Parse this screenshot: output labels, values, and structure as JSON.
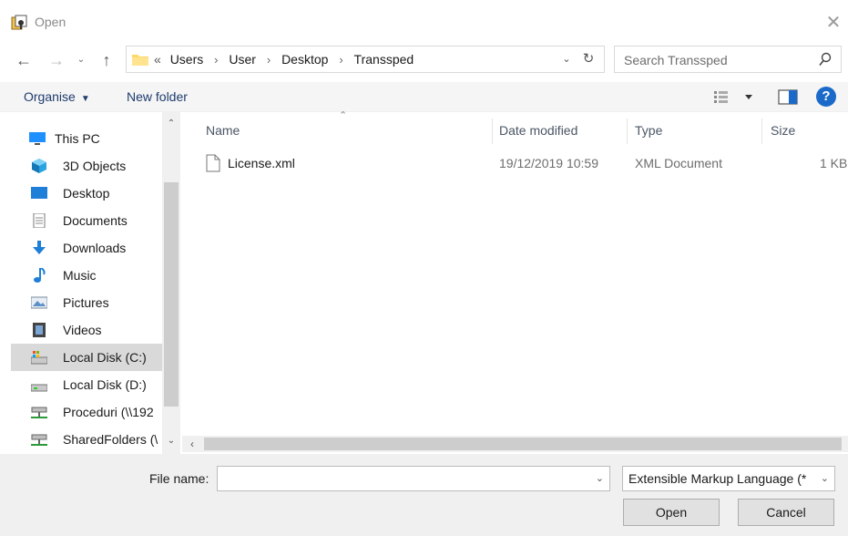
{
  "window": {
    "title": "Open",
    "close_glyph": "✕"
  },
  "nav": {
    "back_glyph": "←",
    "forward_glyph": "→",
    "recent_glyph": "⌄",
    "up_glyph": "↑"
  },
  "address": {
    "overflow": "«",
    "crumbs": [
      "Users",
      "User",
      "Desktop",
      "Transsped"
    ],
    "separator": "›",
    "dropdown_glyph": "⌄",
    "refresh_glyph": "↻"
  },
  "search": {
    "placeholder": "Search Transsped"
  },
  "toolbar": {
    "organise_label": "Organise",
    "organise_caret": "▼",
    "new_folder_label": "New folder",
    "help_glyph": "?"
  },
  "navpane": {
    "items": [
      {
        "label": "This PC",
        "icon": "computer-icon"
      },
      {
        "label": "3D Objects",
        "icon": "cube-icon"
      },
      {
        "label": "Desktop",
        "icon": "desktop-icon"
      },
      {
        "label": "Documents",
        "icon": "documents-icon"
      },
      {
        "label": "Downloads",
        "icon": "download-icon"
      },
      {
        "label": "Music",
        "icon": "music-icon"
      },
      {
        "label": "Pictures",
        "icon": "pictures-icon"
      },
      {
        "label": "Videos",
        "icon": "videos-icon"
      },
      {
        "label": "Local Disk (C:)",
        "icon": "drive-icon"
      },
      {
        "label": "Local Disk (D:)",
        "icon": "drive-icon"
      },
      {
        "label": "Proceduri (\\\\192",
        "icon": "network-drive-icon"
      },
      {
        "label": "SharedFolders (\\",
        "icon": "network-drive-icon"
      }
    ],
    "selected": "Local Disk (C:)",
    "scroll_up_glyph": "⌃",
    "scroll_down_glyph": "⌄"
  },
  "filelist": {
    "columns": {
      "name": "Name",
      "date": "Date modified",
      "type": "Type",
      "size": "Size"
    },
    "sort_glyph": "⌃",
    "rows": [
      {
        "name": "License.xml",
        "date": "19/12/2019 10:59",
        "type": "XML Document",
        "size": "1 KB"
      }
    ],
    "hscroll_left_glyph": "‹"
  },
  "footer": {
    "file_name_label": "File name:",
    "file_name_value": "",
    "file_name_dropdown": "⌄",
    "filter_label": "Extensible Markup Language (*",
    "filter_dropdown": "⌄",
    "open_label": "Open",
    "cancel_label": "Cancel"
  },
  "colors": {
    "accent": "#1b6ac9",
    "toolbar_text": "#1f3c6e",
    "selected_bg": "#d9d9d9"
  }
}
